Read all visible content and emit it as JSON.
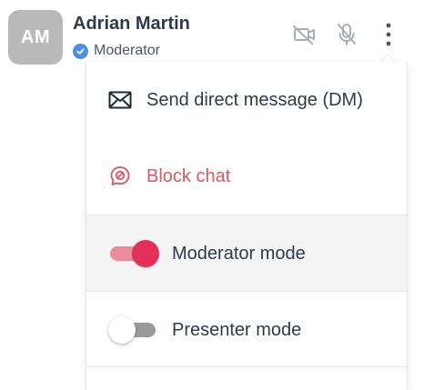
{
  "participant": {
    "initials": "AM",
    "name": "Adrian Martin",
    "role": "Moderator"
  },
  "header_actions": [
    {
      "icon": "video-off-icon"
    },
    {
      "icon": "mic-off-icon"
    },
    {
      "icon": "more-vertical-icon"
    }
  ],
  "menu": {
    "send_dm_label": "Send direct message (DM)",
    "block_chat_label": "Block chat",
    "moderator_mode_label": "Moderator mode",
    "moderator_mode_on": true,
    "presenter_mode_label": "Presenter mode",
    "presenter_mode_on": false
  },
  "colors": {
    "avatar_bg": "#b9b9b9",
    "verified": "#4f8ee8",
    "danger": "#e0535f",
    "toggle_on": "#e3305a"
  }
}
